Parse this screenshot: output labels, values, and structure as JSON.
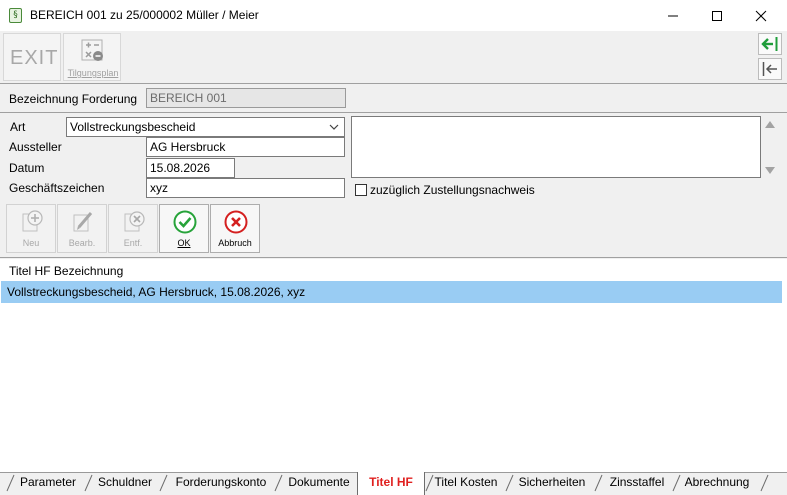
{
  "window": {
    "title": "BEREICH 001 zu 25/000002 Müller / Meier",
    "app_icon_glyph": "§"
  },
  "toolbar": {
    "exit_label": "EXIT",
    "tilgungsplan_label": "Tilgungsplan"
  },
  "form": {
    "bezeichnung_label": "Bezeichnung Forderung",
    "bezeichnung_value": "BEREICH 001",
    "art_label": "Art",
    "art_value": "Vollstreckungsbescheid",
    "aussteller_label": "Aussteller",
    "aussteller_value": "AG Hersbruck",
    "datum_label": "Datum",
    "datum_value": "15.08.2026",
    "geschaeftszeichen_label": "Geschäftszeichen",
    "geschaeftszeichen_value": "xyz",
    "zustellung_label": "zuzüglich Zustellungsnachweis",
    "zustellung_checked": false,
    "notes_value": ""
  },
  "actions": {
    "neu": "Neu",
    "bearb": "Bearb.",
    "entf": "Entf.",
    "ok": "OK",
    "abbruch": "Abbruch"
  },
  "list": {
    "header": "Titel HF Bezeichnung",
    "rows": [
      "Vollstreckungsbescheid, AG Hersbruck, 15.08.2026, xyz"
    ],
    "selected_color": "#99ccf3"
  },
  "tabs": [
    "Parameter",
    "Schuldner",
    "Forderungskonto",
    "Dokumente",
    "Titel HF",
    "Titel Kosten",
    "Sicherheiten",
    "Zinsstaffel",
    "Abrechnung"
  ],
  "active_tab": "Titel HF",
  "colors": {
    "active_tab_text": "#e0201f",
    "ok_green": "#27a33a",
    "abbruch_red": "#d42020",
    "nav_arrow_green": "#1f9d3a"
  }
}
